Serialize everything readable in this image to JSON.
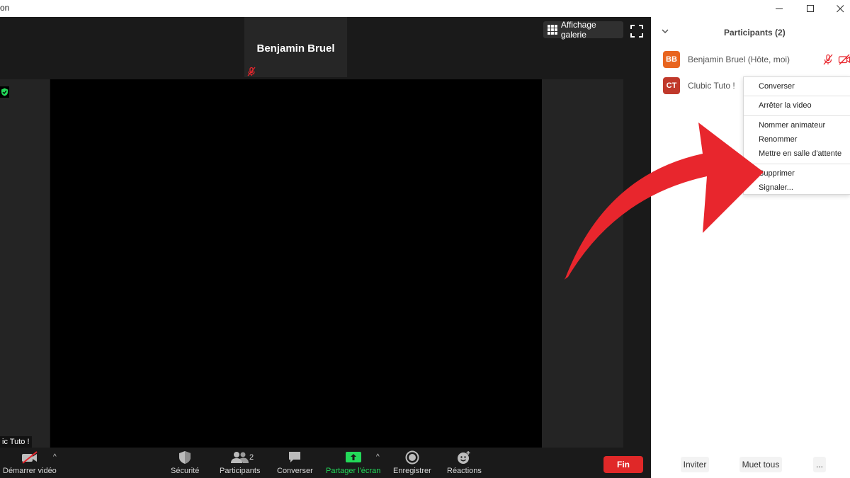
{
  "window": {
    "title": "on",
    "minimize": "—",
    "maximize": "☐",
    "close": "✕"
  },
  "video": {
    "thumbnail_name": "Benjamin Bruel",
    "gallery_label": "Affichage galerie",
    "name_tag": "ic Tuto !"
  },
  "toolbar": {
    "video_label": "Démarrer vidéo",
    "security_label": "Sécurité",
    "participants_label": "Participants",
    "participants_count": "2",
    "chat_label": "Converser",
    "share_label": "Partager l'écran",
    "record_label": "Enregistrer",
    "reactions_label": "Réactions",
    "end_label": "Fin",
    "caret": "^"
  },
  "panel": {
    "title": "Participants (2)",
    "participants": [
      {
        "initials": "BB",
        "name": "Benjamin Bruel (Hôte, moi)",
        "color": "#e8641e"
      },
      {
        "initials": "CT",
        "name": "Clubic Tuto !",
        "color": "#c0392b"
      }
    ],
    "context_menu": [
      "Converser",
      "Arrêter la video",
      "Nommer animateur",
      "Renommer",
      "Mettre en salle d'attente",
      "Supprimer",
      "Signaler..."
    ],
    "invite_label": "Inviter",
    "mute_all_label": "Muet tous",
    "more_label": "..."
  },
  "colors": {
    "accent_red": "#e8262d",
    "share_green": "#23d959",
    "end_red": "#e02828"
  }
}
